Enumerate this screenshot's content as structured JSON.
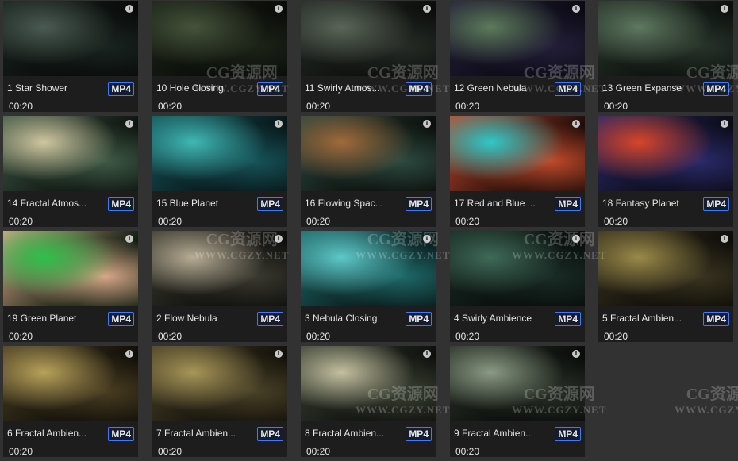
{
  "info_icon_glyph": "i",
  "items": [
    {
      "title": "1 Star Shower",
      "format": "MP4",
      "duration": "00:20",
      "colors": [
        "#4a5a52",
        "#1a2420",
        "#070908"
      ]
    },
    {
      "title": "10 Hole Closing",
      "format": "MP4",
      "duration": "00:20",
      "colors": [
        "#46533a",
        "#1c2418",
        "#080a07"
      ]
    },
    {
      "title": "11 Swirly Atmos...",
      "format": "MP4",
      "duration": "00:20",
      "colors": [
        "#5a6658",
        "#262c26",
        "#0a0c0a"
      ]
    },
    {
      "title": "12 Green Nebula",
      "format": "MP4",
      "duration": "00:20",
      "colors": [
        "#5c7a5a",
        "#241f3a",
        "#0a0912"
      ]
    },
    {
      "title": "13 Green Expanse",
      "format": "MP4",
      "duration": "00:20",
      "colors": [
        "#5e7860",
        "#28342a",
        "#0a0e0b"
      ]
    },
    {
      "title": "14 Fractal Atmos...",
      "format": "MP4",
      "duration": "00:20",
      "colors": [
        "#cfc6a0",
        "#3f5a46",
        "#0c120e"
      ]
    },
    {
      "title": "15 Blue Planet",
      "format": "MP4",
      "duration": "00:20",
      "colors": [
        "#3fb8b4",
        "#17545a",
        "#061416"
      ]
    },
    {
      "title": "16 Flowing Spac...",
      "format": "MP4",
      "duration": "00:20",
      "colors": [
        "#a06a3a",
        "#2c4a40",
        "#0a0c0a"
      ]
    },
    {
      "title": "17 Red and Blue ...",
      "format": "MP4",
      "duration": "00:20",
      "colors": [
        "#2ec8c8",
        "#c04a2a",
        "#1a0a08"
      ]
    },
    {
      "title": "18 Fantasy Planet",
      "format": "MP4",
      "duration": "00:20",
      "colors": [
        "#d8452a",
        "#2a2a6a",
        "#0a0a14"
      ]
    },
    {
      "title": "19 Green Planet",
      "format": "MP4",
      "duration": "00:20",
      "colors": [
        "#2ec04a",
        "#d8a888",
        "#0c1a0e"
      ]
    },
    {
      "title": "2 Flow Nebula",
      "format": "MP4",
      "duration": "00:20",
      "colors": [
        "#b8ad95",
        "#3a3a30",
        "#0c0c0a"
      ]
    },
    {
      "title": "3 Nebula Closing",
      "format": "MP4",
      "duration": "00:20",
      "colors": [
        "#5ec8c8",
        "#1f6a6a",
        "#081616"
      ]
    },
    {
      "title": "4 Swirly Ambience",
      "format": "MP4",
      "duration": "00:20",
      "colors": [
        "#3f6a58",
        "#1a2c26",
        "#070b09"
      ]
    },
    {
      "title": "5 Fractal Ambien...",
      "format": "MP4",
      "duration": "00:20",
      "colors": [
        "#9a8a48",
        "#3a3420",
        "#0c0b07"
      ]
    },
    {
      "title": "6 Fractal Ambien...",
      "format": "MP4",
      "duration": "00:20",
      "colors": [
        "#b8a25a",
        "#4a3e22",
        "#0e0c07"
      ]
    },
    {
      "title": "7 Fractal Ambien...",
      "format": "MP4",
      "duration": "00:20",
      "colors": [
        "#a89658",
        "#4a4228",
        "#100e08"
      ]
    },
    {
      "title": "8 Fractal Ambien...",
      "format": "MP4",
      "duration": "00:20",
      "colors": [
        "#c4c0a0",
        "#3a4234",
        "#0c0e0b"
      ]
    },
    {
      "title": "9 Fractal Ambien...",
      "format": "MP4",
      "duration": "00:20",
      "colors": [
        "#8a9a84",
        "#2a3228",
        "#080a08"
      ]
    }
  ],
  "watermark": {
    "logo": "CG资源网",
    "url": "WWW.CGZY.NET"
  }
}
